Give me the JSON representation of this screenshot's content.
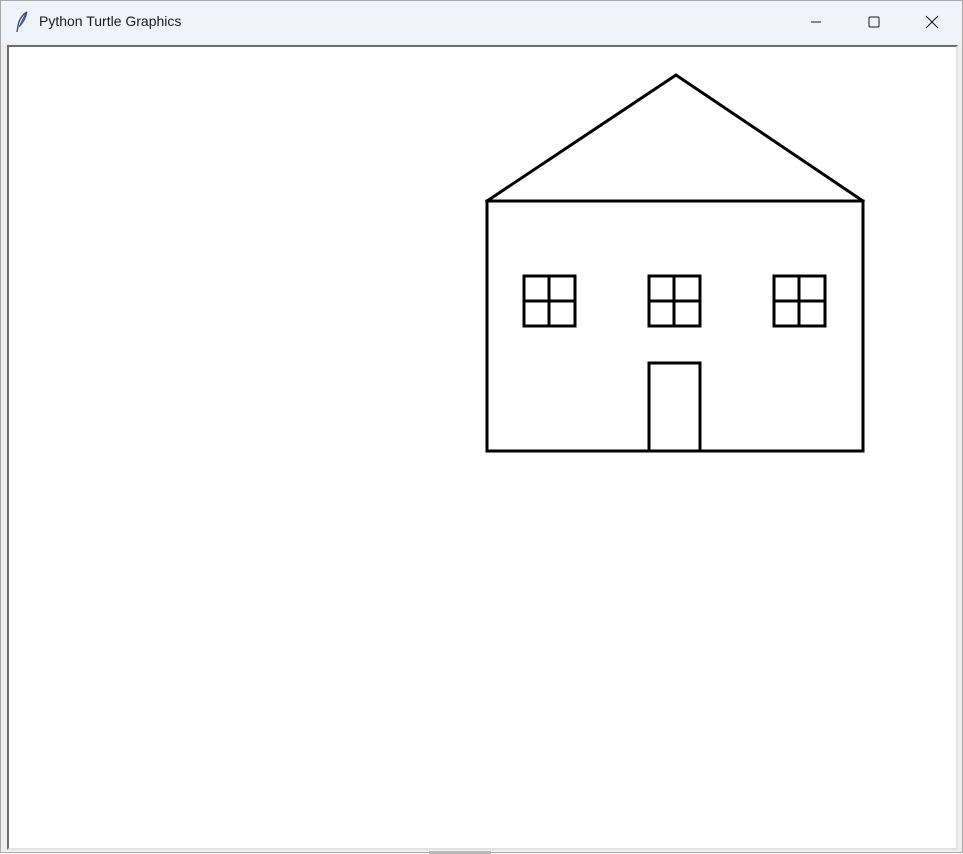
{
  "window": {
    "title": "Python Turtle Graphics",
    "app_icon": "feather-icon"
  },
  "controls": {
    "minimize_icon": "minimize-icon",
    "maximize_icon": "maximize-icon",
    "close_icon": "close-icon"
  },
  "canvas": {
    "background": "#ffffff",
    "pen_color": "#000000",
    "drawing": "house",
    "windows_count": 3
  }
}
